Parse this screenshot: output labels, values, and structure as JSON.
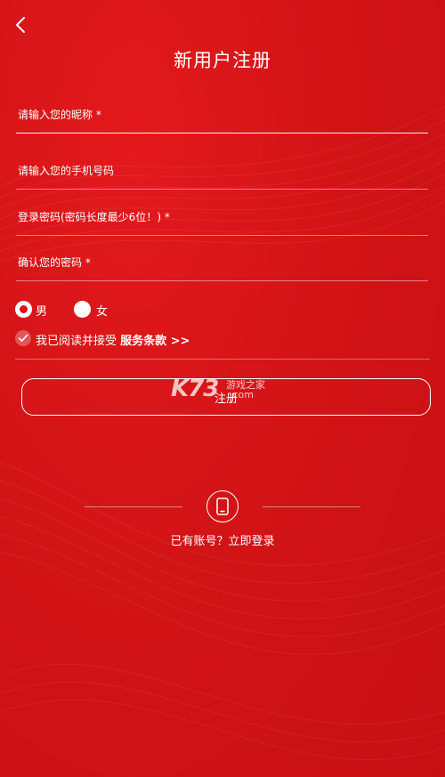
{
  "header": {
    "title": "新用户注册",
    "back_icon": "chevron-left-icon"
  },
  "form": {
    "nickname_placeholder": "请输入您的昵称 *",
    "phone_placeholder": "请输入您的手机号码",
    "password_placeholder": "登录密码(密码长度最少6位！) *",
    "confirm_placeholder": "确认您的密码 *"
  },
  "gender": {
    "male_label": "男",
    "female_label": "女",
    "selected": "男"
  },
  "agreement": {
    "checked": true,
    "text": "我已阅读并接受 ",
    "terms_link": "服务条款 >>"
  },
  "register_button": "注册",
  "watermark": {
    "logo": "K73",
    "line1": "游戏之家",
    "line2": ".com"
  },
  "login": {
    "icon": "phone-icon",
    "link_text": "已有账号？立即登录"
  },
  "colors": {
    "background": "#d81418",
    "foreground": "#ffffff"
  }
}
